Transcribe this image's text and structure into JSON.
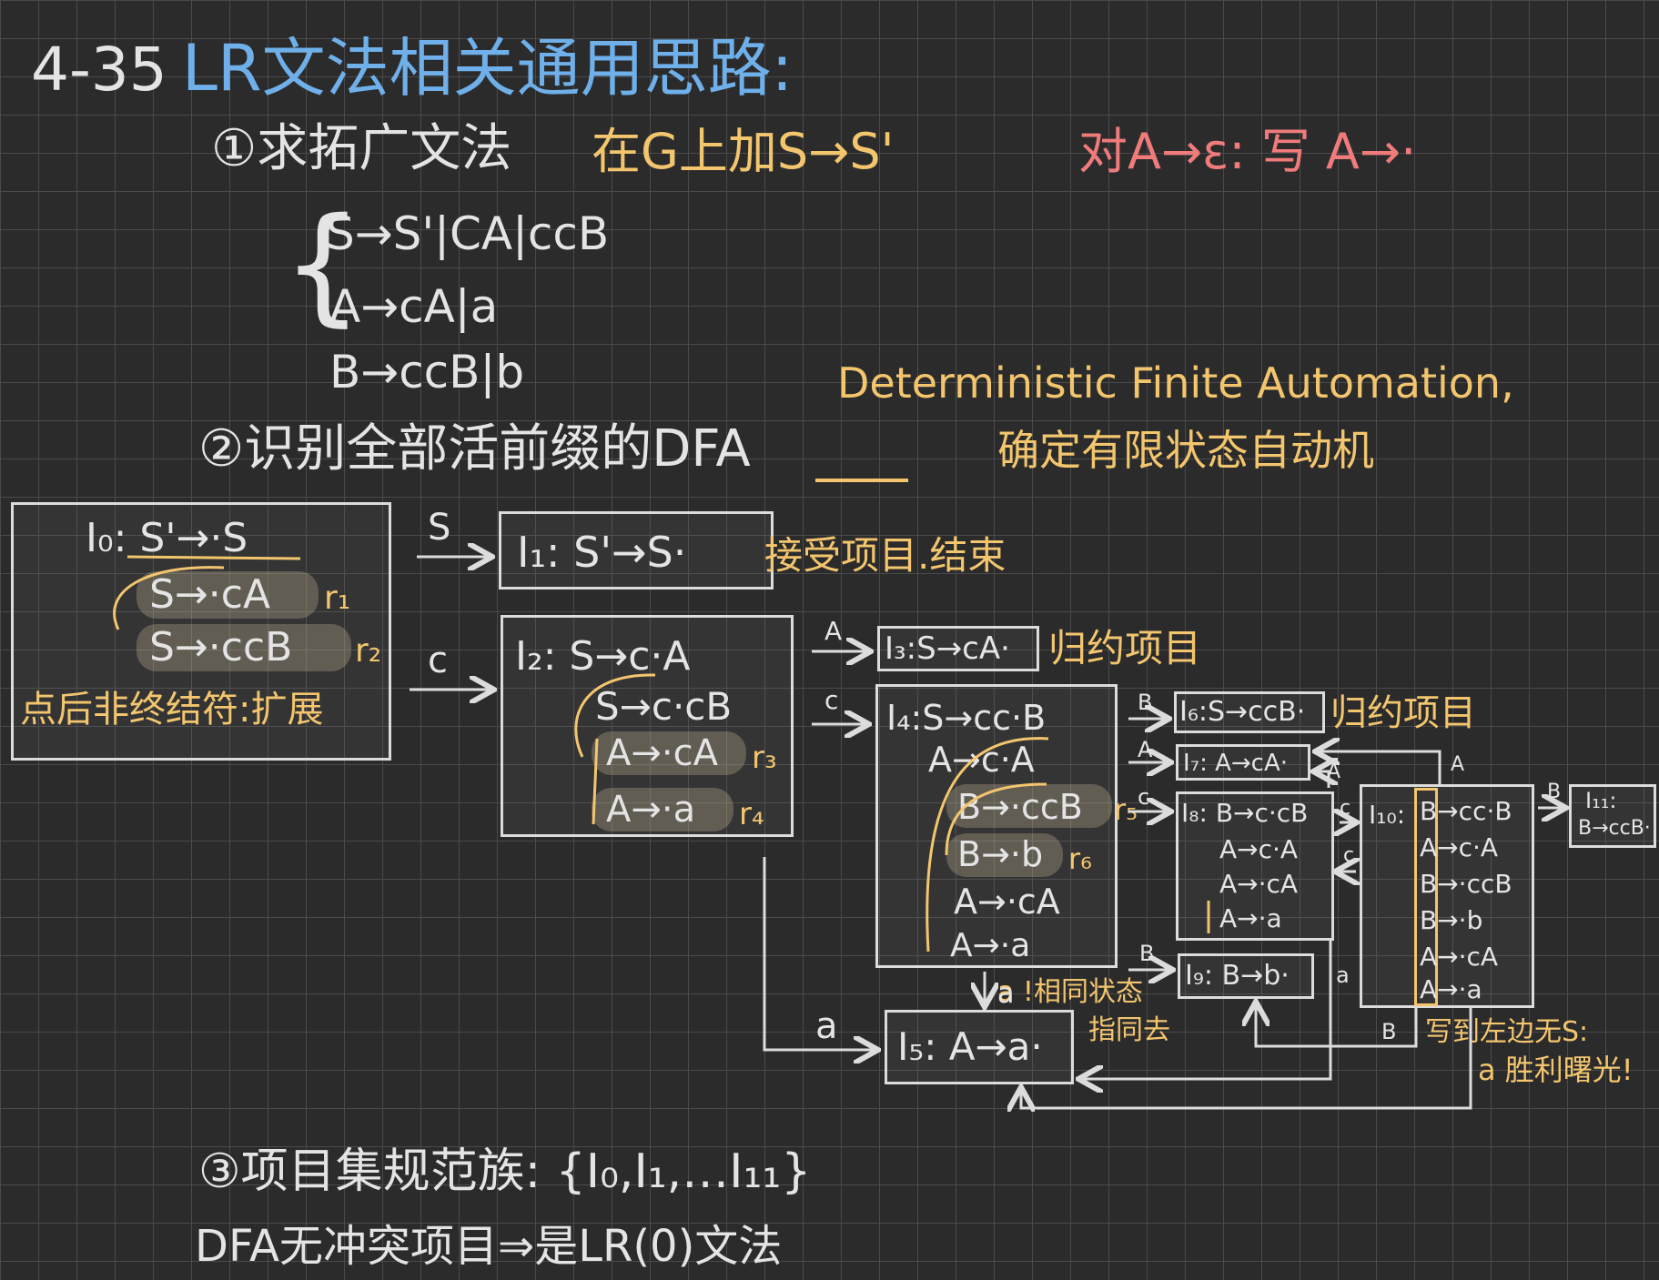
{
  "title": {
    "number": "4-35",
    "text": "LR文法相关通用思路:"
  },
  "step1": {
    "label": "①求拓广文法",
    "note": "在G上加S→S'",
    "epsilon_note": "对A→ε: 写 A→·"
  },
  "grammar": [
    "S→S'|CA|ccB",
    "A→cA|a",
    "B→ccB|b"
  ],
  "dfa_note": {
    "en": "Deterministic Finite Automation,",
    "zh": "确定有限状态自动机"
  },
  "step2": {
    "label": "②识别全部活前缀的DFA"
  },
  "states": {
    "I0": {
      "head": "I₀: S'→·S",
      "items": [
        "S→·cA",
        "S→·ccB"
      ],
      "tags": [
        "r₁",
        "r₂"
      ],
      "note": "点后非终结符:扩展"
    },
    "I1": {
      "head": "I₁: S'→S·",
      "note": "接受项目.结束"
    },
    "I2": {
      "head": "I₂: S→c·A",
      "items": [
        "S→c·cB",
        "A→·cA",
        "A→·a"
      ],
      "tags": [
        "r₃",
        "r₄"
      ]
    },
    "I3": {
      "head": "I₃:S→cA·",
      "note": "归约项目"
    },
    "I4": {
      "head": "I₄:S→cc·B",
      "items": [
        "A→c·A",
        "B→·ccB",
        "B→·b",
        "A→·cA",
        "A→·a"
      ],
      "tags": [
        "r₅",
        "r₆"
      ]
    },
    "I5": {
      "head": "I₅: A→a·",
      "note1": "a !相同状态",
      "note2": "指同去"
    },
    "I6": {
      "head": "I₆:S→ccB·",
      "note": "归约项目"
    },
    "I7": {
      "head": "I₇: A→cA·"
    },
    "I8": {
      "head": "I₈: B→c·cB",
      "items": [
        "A→c·A",
        "A→·cA",
        "A→·a"
      ]
    },
    "I9": {
      "head": "I₉: B→b·"
    },
    "I10": {
      "head": "I₁₀:",
      "items": [
        "B→cc·B",
        "A→c·A",
        "B→·ccB",
        "B→·b",
        "A→·cA",
        "A→·a"
      ],
      "note1": "写到左边无S:",
      "note2": "a 胜利曙光!"
    },
    "I11": {
      "head": "I₁₁:",
      "item": "B→ccB·"
    }
  },
  "edges": {
    "S": "S",
    "c": "c",
    "A": "A",
    "a": "a",
    "b": "B"
  },
  "step3": {
    "label": "③项目集规范族: {I₀,I₁,…I₁₁}",
    "conclusion": "DFA无冲突项目⇒是LR(0)文法"
  },
  "colors": {
    "background": "#2b2b2c",
    "grid": "#4a4a4c",
    "white": "#e4e4e4",
    "yellow": "#f3c66e",
    "blue": "#6fb0ea",
    "red": "#f07b7b"
  }
}
